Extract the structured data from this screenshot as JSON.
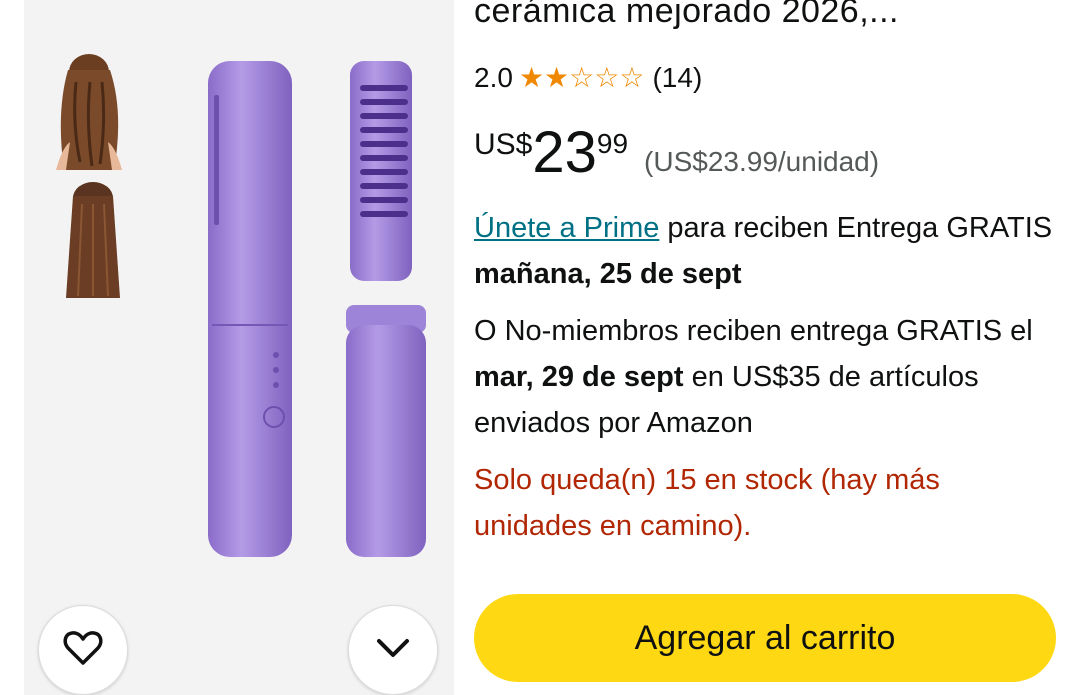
{
  "product": {
    "title_visible": "cerámica mejorado 2026,...",
    "rating_value": "2.0",
    "rating_stars": 2,
    "review_count": "(14)",
    "price_currency": "US$",
    "price_whole": "23",
    "price_fraction": "99",
    "unit_price": "(US$23.99/unidad)"
  },
  "delivery": {
    "prime_link": "Únete a Prime",
    "prime_text_1": " para reciben Entrega GRATIS ",
    "prime_date": "mañana, 25 de sept",
    "nonmember_text_1": "O No-miembros reciben entrega GRATIS el ",
    "nonmember_date": "mar, 29 de sept",
    "nonmember_text_2": " en US$35 de artículos enviados por Amazon"
  },
  "stock": {
    "text": "Solo queda(n) 15 en stock (hay más unidades en camino)."
  },
  "actions": {
    "add_to_cart": "Agregar al carrito"
  },
  "icons": {
    "favorite": "heart-icon",
    "more": "chevron-down-icon",
    "star": "star-icon"
  },
  "colors": {
    "cta_yellow": "#ffd814",
    "star_orange": "#f08804",
    "link_teal": "#007185",
    "stock_red": "#b12704",
    "product_purple": "#9b7fd6"
  }
}
